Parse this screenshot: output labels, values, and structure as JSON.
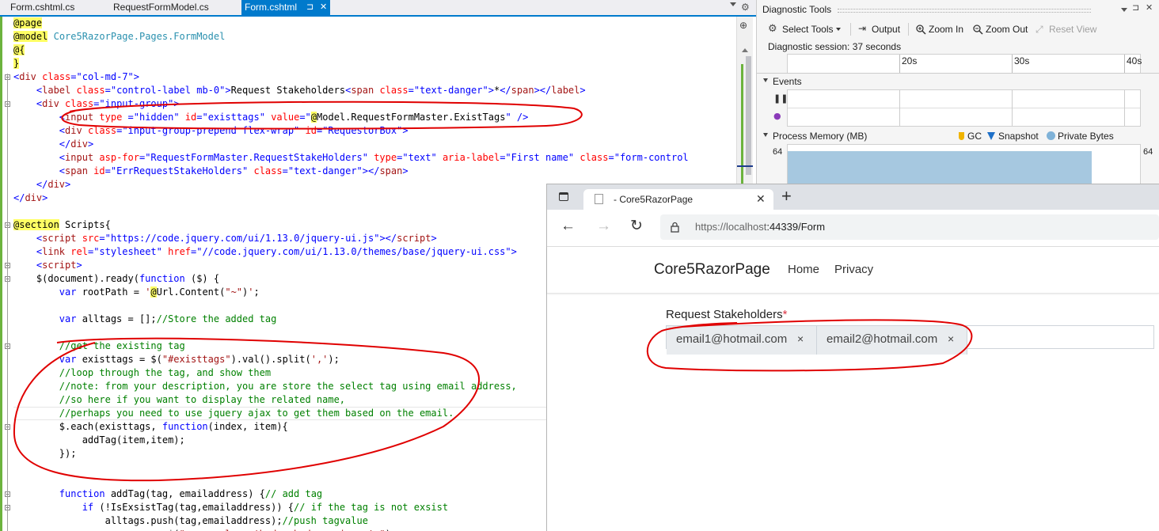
{
  "tabs": [
    {
      "label": "Form.cshtml.cs"
    },
    {
      "label": "RequestFormModel.cs"
    },
    {
      "label": "Form.cshtml",
      "active": true
    }
  ],
  "tab_pin_glyph": "⊐",
  "tab_close_glyph": "✕",
  "code_lines": [
    [
      [
        "@page",
        "cd"
      ]
    ],
    [
      [
        "@model",
        "cd"
      ],
      [
        " ",
        ""
      ],
      [
        "Core5RazorPage.Pages.FormModel",
        "ct"
      ]
    ],
    [
      [
        "@{",
        "cd"
      ]
    ],
    [
      [
        "}",
        "cd"
      ]
    ],
    [
      [
        "<",
        "ck"
      ],
      [
        "div",
        "cs"
      ],
      [
        " ",
        ""
      ],
      [
        "class",
        "ca"
      ],
      [
        "=",
        "ck"
      ],
      [
        "\"col-md-7\"",
        "ck"
      ],
      [
        ">",
        "ck"
      ]
    ],
    [
      [
        "    <",
        "ck"
      ],
      [
        "label",
        "cs"
      ],
      [
        " ",
        ""
      ],
      [
        "class",
        "ca"
      ],
      [
        "=",
        "ck"
      ],
      [
        "\"control-label mb-0\"",
        "ck"
      ],
      [
        ">",
        "ck"
      ],
      [
        "Request Stakeholders",
        "cr"
      ],
      [
        "<",
        "ck"
      ],
      [
        "span",
        "cs"
      ],
      [
        " ",
        ""
      ],
      [
        "class",
        "ca"
      ],
      [
        "=",
        "ck"
      ],
      [
        "\"text-danger\"",
        "ck"
      ],
      [
        ">",
        "ck"
      ],
      [
        "*",
        "cr"
      ],
      [
        "</",
        "ck"
      ],
      [
        "span",
        "cs"
      ],
      [
        "></",
        "ck"
      ],
      [
        "label",
        "cs"
      ],
      [
        ">",
        "ck"
      ]
    ],
    [
      [
        "    <",
        "ck"
      ],
      [
        "div",
        "cs"
      ],
      [
        " ",
        ""
      ],
      [
        "class",
        "ca"
      ],
      [
        "=",
        "ck"
      ],
      [
        "\"input-group\"",
        "ck"
      ],
      [
        ">",
        "ck"
      ]
    ],
    [
      [
        "        <",
        "ck"
      ],
      [
        "input",
        "cs"
      ],
      [
        " ",
        ""
      ],
      [
        "type",
        "ca"
      ],
      [
        " =",
        "ck"
      ],
      [
        "\"hidden\"",
        "ck"
      ],
      [
        " ",
        ""
      ],
      [
        "id",
        "ca"
      ],
      [
        "=",
        "ck"
      ],
      [
        "\"existtags\"",
        "ck"
      ],
      [
        " ",
        ""
      ],
      [
        "value",
        "ca"
      ],
      [
        "=",
        "ck"
      ],
      [
        "\"",
        "ck"
      ],
      [
        "@",
        "cd"
      ],
      [
        "Model.RequestFormMaster.ExistTags",
        "cr"
      ],
      [
        "\"",
        "ck"
      ],
      [
        " />",
        "ck"
      ]
    ],
    [
      [
        "        <",
        "ck"
      ],
      [
        "div",
        "cs"
      ],
      [
        " ",
        ""
      ],
      [
        "class",
        "ca"
      ],
      [
        "=",
        "ck"
      ],
      [
        "\"input-group-prepend flex-wrap\"",
        "ck"
      ],
      [
        " ",
        ""
      ],
      [
        "id",
        "ca"
      ],
      [
        "=",
        "ck"
      ],
      [
        "\"RequestorBox\"",
        "ck"
      ],
      [
        ">",
        "ck"
      ]
    ],
    [
      [
        "        </",
        "ck"
      ],
      [
        "div",
        "cs"
      ],
      [
        ">",
        "ck"
      ]
    ],
    [
      [
        "        <",
        "ck"
      ],
      [
        "input",
        "cs"
      ],
      [
        " ",
        ""
      ],
      [
        "asp-for",
        "ca"
      ],
      [
        "=",
        "ck"
      ],
      [
        "\"RequestFormMaster.RequestStakeHolders\"",
        "ck"
      ],
      [
        " ",
        ""
      ],
      [
        "type",
        "ca"
      ],
      [
        "=",
        "ck"
      ],
      [
        "\"text\"",
        "ck"
      ],
      [
        " ",
        ""
      ],
      [
        "aria-label",
        "ca"
      ],
      [
        "=",
        "ck"
      ],
      [
        "\"First name\"",
        "ck"
      ],
      [
        " ",
        ""
      ],
      [
        "class",
        "ca"
      ],
      [
        "=",
        "ck"
      ],
      [
        "\"form-control",
        "ck"
      ]
    ],
    [
      [
        "        <",
        "ck"
      ],
      [
        "span",
        "cs"
      ],
      [
        " ",
        ""
      ],
      [
        "id",
        "ca"
      ],
      [
        "=",
        "ck"
      ],
      [
        "\"ErrRequestStakeHolders\"",
        "ck"
      ],
      [
        " ",
        ""
      ],
      [
        "class",
        "ca"
      ],
      [
        "=",
        "ck"
      ],
      [
        "\"text-danger\"",
        "ck"
      ],
      [
        "></",
        "ck"
      ],
      [
        "span",
        "cs"
      ],
      [
        ">",
        "ck"
      ]
    ],
    [
      [
        "    </",
        "ck"
      ],
      [
        "div",
        "cs"
      ],
      [
        ">",
        "ck"
      ]
    ],
    [
      [
        "</",
        "ck"
      ],
      [
        "div",
        "cs"
      ],
      [
        ">",
        "ck"
      ]
    ],
    [],
    [
      [
        "@section",
        "cd"
      ],
      [
        " Scripts{",
        "cr"
      ]
    ],
    [
      [
        "    <",
        "ck"
      ],
      [
        "script",
        "cs"
      ],
      [
        " ",
        ""
      ],
      [
        "src",
        "ca"
      ],
      [
        "=",
        "ck"
      ],
      [
        "\"",
        "ck"
      ],
      [
        "https://code.jquery.com/ui/1.13.0/jquery-ui.js",
        "ck"
      ],
      [
        "\"",
        "ck"
      ],
      [
        "></",
        "ck"
      ],
      [
        "script",
        "cs"
      ],
      [
        ">",
        "ck"
      ]
    ],
    [
      [
        "    <",
        "ck"
      ],
      [
        "link",
        "cs"
      ],
      [
        " ",
        ""
      ],
      [
        "rel",
        "ca"
      ],
      [
        "=",
        "ck"
      ],
      [
        "\"stylesheet\"",
        "ck"
      ],
      [
        " ",
        ""
      ],
      [
        "href",
        "ca"
      ],
      [
        "=",
        "ck"
      ],
      [
        "\"//code.jquery.com/ui/1.13.0/themes/base/jquery-ui.css\"",
        "ck"
      ],
      [
        ">",
        "ck"
      ]
    ],
    [
      [
        "    <",
        "ck"
      ],
      [
        "script",
        "cs"
      ],
      [
        ">",
        "ck"
      ]
    ],
    [
      [
        "    $(document).ready(",
        "cr"
      ],
      [
        "function",
        "ck"
      ],
      [
        " ($) {",
        "cr"
      ]
    ],
    [
      [
        "        ",
        "cr"
      ],
      [
        "var",
        "ck"
      ],
      [
        " rootPath = ",
        "cr"
      ],
      [
        "'",
        "cs"
      ],
      [
        "@",
        "cd"
      ],
      [
        "Url.Content(",
        "cr"
      ],
      [
        "\"~\"",
        "cs"
      ],
      [
        ")",
        "cr"
      ],
      [
        "'",
        "cs"
      ],
      [
        ";",
        "cr"
      ]
    ],
    [],
    [
      [
        "        ",
        "cr"
      ],
      [
        "var",
        "ck"
      ],
      [
        " alltags = [];",
        "cr"
      ],
      [
        "//Store the added tag",
        "cc"
      ]
    ],
    [],
    [
      [
        "        //get the existing tag",
        "cc"
      ]
    ],
    [
      [
        "        ",
        "cr"
      ],
      [
        "var",
        "ck"
      ],
      [
        " existtags = $(",
        "cr"
      ],
      [
        "\"#existtags\"",
        "cs"
      ],
      [
        ").val().split(",
        "cr"
      ],
      [
        "','",
        "cs"
      ],
      [
        ");",
        "cr"
      ]
    ],
    [
      [
        "        //loop through the tag, and show them",
        "cc"
      ]
    ],
    [
      [
        "        //note: from your description, you are store the select tag using email address,",
        "cc"
      ]
    ],
    [
      [
        "        //so here if you want to display the related name,",
        "cc"
      ]
    ],
    [
      [
        "        //perhaps you need to use jquery ajax to get them based on the email.",
        "cc"
      ]
    ],
    [
      [
        "        $.each(existtags, ",
        "cr"
      ],
      [
        "function",
        "ck"
      ],
      [
        "(index, item){",
        "cr"
      ]
    ],
    [
      [
        "            addTag(item,item);",
        "cr"
      ]
    ],
    [
      [
        "        });",
        "cr"
      ]
    ],
    [],
    [],
    [
      [
        "        ",
        "cr"
      ],
      [
        "function",
        "ck"
      ],
      [
        " addTag(tag, emailaddress) {",
        "cr"
      ],
      [
        "// add tag",
        "cc"
      ]
    ],
    [
      [
        "            ",
        "cr"
      ],
      [
        "if",
        "ck"
      ],
      [
        " (!IsExsistTag(tag,emailaddress)) {",
        "cr"
      ],
      [
        "// if the tag is not exsist",
        "cc"
      ]
    ],
    [
      [
        "                alltags.push(tag,emailaddress);",
        "cr"
      ],
      [
        "//push tagvalue",
        "cc"
      ]
    ],
    [
      [
        "                ",
        "cr"
      ],
      [
        "var",
        "ck"
      ],
      [
        " span = $(",
        "cr"
      ],
      [
        "\"<span class='badge badge-primary'>\"",
        "cs"
      ],
      [
        ");",
        "cr"
      ]
    ]
  ],
  "diag": {
    "title": "Diagnostic Tools",
    "toolbar": {
      "select_tools": "Select Tools",
      "output": "Output",
      "zoom_in": "Zoom In",
      "zoom_out": "Zoom Out",
      "reset_view": "Reset View"
    },
    "session": "Diagnostic session: 37 seconds",
    "ticks": [
      "20s",
      "30s",
      "40s"
    ],
    "events_label": "Events",
    "memory_label": "Process Memory (MB)",
    "legend": {
      "gc": "GC",
      "snapshot": "Snapshot",
      "private_bytes": "Private Bytes"
    },
    "mem_left": "64",
    "mem_right": "64",
    "colors": {
      "gc": "#f0b400",
      "snapshot": "#1e70c8",
      "private_bytes": "#7fb2d8"
    }
  },
  "browser": {
    "tab_title": "- Core5RazorPage",
    "address_host": "https://localhost",
    "address_rest": ":44339/Form",
    "brand": "Core5RazorPage",
    "nav": [
      "Home",
      "Privacy"
    ],
    "label": "Request Stakeholders",
    "required": "*",
    "tags": [
      {
        "text": "email1@hotmail.com",
        "remove": "×"
      },
      {
        "text": "email2@hotmail.com",
        "remove": "×"
      }
    ]
  }
}
